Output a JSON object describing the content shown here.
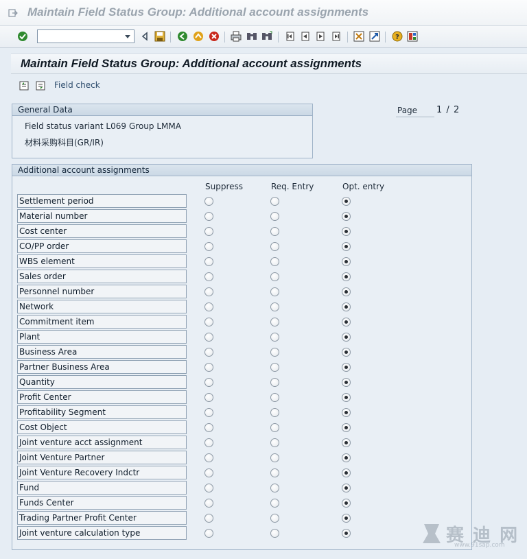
{
  "window": {
    "title": "Maintain Field Status Group: Additional account assignments"
  },
  "toolbar": {
    "command_field_value": "",
    "icons": [
      "enter-icon",
      "command-dropdown-icon",
      "collapse-command-icon",
      "save-icon",
      "back-icon",
      "exit-icon",
      "cancel-icon",
      "print-icon",
      "find-icon",
      "find-next-icon",
      "first-page-icon",
      "previous-page-icon",
      "next-page-icon",
      "last-page-icon",
      "create-session-icon",
      "shortcut-icon",
      "help-icon",
      "layout-menu-icon"
    ]
  },
  "screen": {
    "title": "Maintain Field Status Group: Additional account assignments"
  },
  "app_toolbar": {
    "field_check_label": "Field check",
    "icons": [
      "previous-group-icon",
      "next-group-icon"
    ]
  },
  "general_data": {
    "title": "General Data",
    "field_status_variant": "Field status variant L069",
    "group": "Group LMMA",
    "group_text": "材料采购科目(GR/IR)"
  },
  "paging": {
    "label": "Page",
    "current": "1",
    "separator": "/",
    "total": "2"
  },
  "assignments": {
    "title": "Additional account assignments",
    "columns": [
      "Suppress",
      "Req. Entry",
      "Opt. entry"
    ],
    "rows": [
      {
        "label": "Settlement period",
        "selected": "Opt. entry"
      },
      {
        "label": "Material number",
        "selected": "Opt. entry"
      },
      {
        "label": "Cost center",
        "selected": "Opt. entry"
      },
      {
        "label": "CO/PP order",
        "selected": "Opt. entry"
      },
      {
        "label": "WBS element",
        "selected": "Opt. entry"
      },
      {
        "label": "Sales order",
        "selected": "Opt. entry"
      },
      {
        "label": "Personnel number",
        "selected": "Opt. entry"
      },
      {
        "label": "Network",
        "selected": "Opt. entry"
      },
      {
        "label": "Commitment item",
        "selected": "Opt. entry"
      },
      {
        "label": "Plant",
        "selected": "Opt. entry"
      },
      {
        "label": "Business Area",
        "selected": "Opt. entry"
      },
      {
        "label": "Partner Business Area",
        "selected": "Opt. entry"
      },
      {
        "label": "Quantity",
        "selected": "Opt. entry"
      },
      {
        "label": "Profit Center",
        "selected": "Opt. entry"
      },
      {
        "label": "Profitability Segment",
        "selected": "Opt. entry"
      },
      {
        "label": "Cost Object",
        "selected": "Opt. entry"
      },
      {
        "label": "Joint venture acct assignment",
        "selected": "Opt. entry"
      },
      {
        "label": "Joint Venture Partner",
        "selected": "Opt. entry"
      },
      {
        "label": "Joint Venture Recovery Indctr",
        "selected": "Opt. entry"
      },
      {
        "label": "Fund",
        "selected": "Opt. entry"
      },
      {
        "label": "Funds Center",
        "selected": "Opt. entry"
      },
      {
        "label": "Trading Partner Profit Center",
        "selected": "Opt. entry"
      },
      {
        "label": "Joint venture calculation type",
        "selected": "Opt. entry"
      }
    ]
  },
  "watermark": {
    "text": "赛 迪 网",
    "url": "www.91sap.com"
  }
}
